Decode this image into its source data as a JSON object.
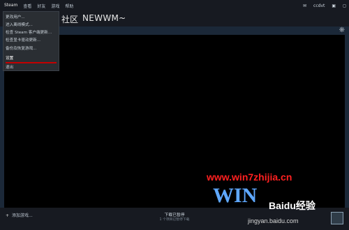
{
  "menubar": {
    "items": [
      "Steam",
      "查看",
      "好友",
      "游戏",
      "帮助"
    ]
  },
  "header": {
    "community": "社区",
    "username": "NEWWM~",
    "account_name": "ccdvt"
  },
  "dropdown": {
    "items": [
      "更改用户...",
      "进入离线模式...",
      "检查 Steam 客户端更新...",
      "检查显卡驱动更新...",
      "备份及恢复游戏...",
      "设置",
      "退出"
    ],
    "selected_index": 5,
    "highlight_color": "#c40000"
  },
  "bottombar": {
    "add_game": "添加游戏...",
    "download_status": "下载已暂停",
    "download_sub": "1 个项目已暂停下载"
  },
  "watermark": {
    "site_url": "www.win7zhijia.cn",
    "brand_text": "WIN",
    "baidu_logo": "Baidu经验",
    "baidu_url": "jingyan.baidu.com"
  },
  "colors": {
    "background": "#1b2838",
    "menu_bg": "#2a2e33",
    "accent_red": "#c40000"
  }
}
